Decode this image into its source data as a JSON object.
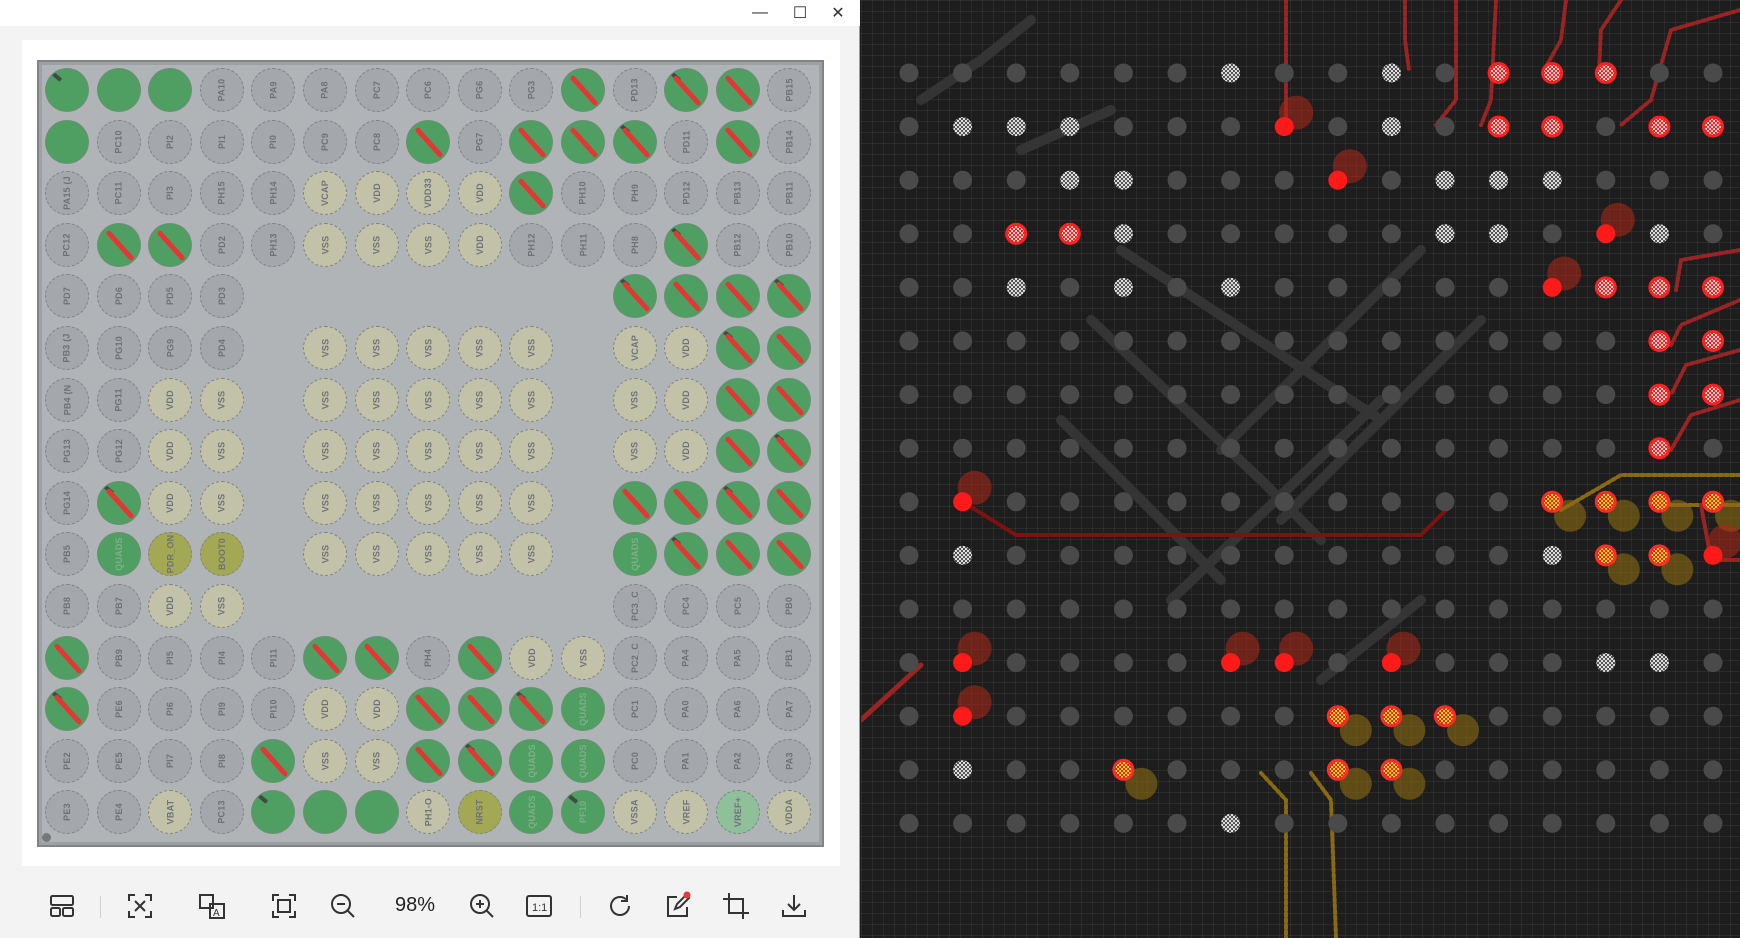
{
  "window": {
    "controls": {
      "minimize": "—",
      "maximize": "☐",
      "close": "✕"
    }
  },
  "colors": {
    "board": "#b1b4b7",
    "pin_gray": "#a4a8ac",
    "pin_power": "#c2c2a8",
    "pin_assigned": "#4f9e62",
    "pin_olive": "#a3a854",
    "route_mark": "#e53535",
    "pcb_background": "#1d1d1d",
    "pad_red": "#ff1a1a",
    "pad_yellow": "#f5e200"
  },
  "pin_grid": {
    "rows": [
      [
        "",
        "",
        "",
        "PA10",
        "PA9",
        "PA8",
        "PC7",
        "PC6",
        "PG6",
        "PG3",
        "",
        "PD13",
        "",
        "",
        "PB15"
      ],
      [
        "",
        "PC10",
        "PI2",
        "PI1",
        "PI0",
        "PC9",
        "PC8",
        "",
        "PG7",
        "",
        "",
        "",
        "PD11",
        "",
        "PB14"
      ],
      [
        "PA15 (J",
        "PC11",
        "PI3",
        "PH15",
        "PH14",
        "VCAP",
        "VDD",
        "VDD33",
        "VDD",
        "",
        "PH10",
        "PH9",
        "PD12",
        "PB13",
        "PB11"
      ],
      [
        "PC12",
        "",
        "",
        "PD2",
        "PH13",
        "VSS",
        "VSS",
        "VSS",
        "VDD",
        "PH12",
        "PH11",
        "PH8",
        "",
        "PB12",
        "PB10"
      ],
      [
        "PD7",
        "PD6",
        "PD5",
        "PD3",
        "",
        "",
        "",
        "",
        "",
        "",
        "",
        "",
        "",
        "",
        ""
      ],
      [
        "PB3 (J",
        "PG10",
        "PG9",
        "PD4",
        "",
        "VSS",
        "VSS",
        "VSS",
        "VSS",
        "VSS",
        "",
        "VCAP",
        "VDD",
        "",
        ""
      ],
      [
        "PB4 (N",
        "PG11",
        "VDD",
        "VSS",
        "",
        "VSS",
        "VSS",
        "VSS",
        "VSS",
        "VSS",
        "",
        "VSS",
        "VDD",
        "",
        ""
      ],
      [
        "PG13",
        "PG12",
        "VDD",
        "VSS",
        "",
        "VSS",
        "VSS",
        "VSS",
        "VSS",
        "VSS",
        "",
        "VSS",
        "VDD",
        "",
        ""
      ],
      [
        "PG14",
        "",
        "VDD",
        "VSS",
        "",
        "VSS",
        "VSS",
        "VSS",
        "VSS",
        "VSS",
        "",
        "",
        "",
        "",
        ""
      ],
      [
        "PB5",
        "QUADS",
        "PDR_ON",
        "BOOT0",
        "",
        "VSS",
        "VSS",
        "VSS",
        "VSS",
        "VSS",
        "",
        "QUADS",
        "",
        "",
        ""
      ],
      [
        "PB8",
        "PB7",
        "VDD",
        "VSS",
        "",
        "",
        "",
        "",
        "",
        "",
        "",
        "PC3_C",
        "PC4",
        "PC5",
        "PB0"
      ],
      [
        "",
        "PB9",
        "PI5",
        "PI4",
        "PI11",
        "",
        "",
        "PH4",
        "",
        "VDD",
        "VSS",
        "PC2_C",
        "PA4",
        "PA5",
        "PB1"
      ],
      [
        "",
        "PE6",
        "PI6",
        "PI9",
        "PI10",
        "VDD",
        "VDD",
        "",
        "",
        "",
        "QUADS",
        "PC1",
        "PA0",
        "PA6",
        "PA7"
      ],
      [
        "PE2",
        "PE5",
        "PI7",
        "PI8",
        "",
        "VSS",
        "VSS",
        "",
        "",
        "QUADS",
        "QUADS",
        "PC0",
        "PA1",
        "PA2",
        "PA3"
      ],
      [
        "PE3",
        "PE4",
        "VBAT",
        "PC13",
        "",
        "",
        "",
        "PH1-O",
        "NRST",
        "QUADS",
        "PF10",
        "VSSA",
        "VREF",
        "VREF+",
        "VDDA"
      ]
    ],
    "kinds": [
      [
        "a",
        "a",
        "a",
        "g",
        "g",
        "g",
        "g",
        "g",
        "g",
        "g",
        "a",
        "g",
        "a",
        "a",
        "g"
      ],
      [
        "a",
        "g",
        "g",
        "g",
        "g",
        "g",
        "g",
        "a",
        "g",
        "a",
        "a",
        "a",
        "g",
        "a",
        "g"
      ],
      [
        "g",
        "g",
        "g",
        "g",
        "g",
        "p",
        "p",
        "p",
        "p",
        "a",
        "g",
        "g",
        "g",
        "g",
        "g"
      ],
      [
        "g",
        "a",
        "a",
        "g",
        "g",
        "p",
        "p",
        "p",
        "p",
        "g",
        "g",
        "g",
        "a",
        "g",
        "g"
      ],
      [
        "g",
        "g",
        "g",
        "g",
        "e",
        "e",
        "e",
        "e",
        "e",
        "e",
        "e",
        "a",
        "a",
        "a",
        "a"
      ],
      [
        "g",
        "g",
        "g",
        "g",
        "e",
        "p",
        "p",
        "p",
        "p",
        "p",
        "e",
        "p",
        "p",
        "a",
        "a"
      ],
      [
        "g",
        "g",
        "p",
        "p",
        "e",
        "p",
        "p",
        "p",
        "p",
        "p",
        "e",
        "p",
        "p",
        "a",
        "a"
      ],
      [
        "g",
        "g",
        "p",
        "p",
        "e",
        "p",
        "p",
        "p",
        "p",
        "p",
        "e",
        "p",
        "p",
        "a",
        "a"
      ],
      [
        "g",
        "a",
        "p",
        "p",
        "e",
        "p",
        "p",
        "p",
        "p",
        "p",
        "e",
        "a",
        "a",
        "a",
        "a"
      ],
      [
        "g",
        "a",
        "o",
        "o",
        "e",
        "p",
        "p",
        "p",
        "p",
        "p",
        "e",
        "a",
        "a",
        "a",
        "a"
      ],
      [
        "g",
        "g",
        "p",
        "p",
        "e",
        "e",
        "e",
        "e",
        "e",
        "e",
        "e",
        "g",
        "g",
        "g",
        "g"
      ],
      [
        "a",
        "g",
        "g",
        "g",
        "g",
        "a",
        "a",
        "g",
        "a",
        "p",
        "p",
        "g",
        "g",
        "g",
        "g"
      ],
      [
        "a",
        "g",
        "g",
        "g",
        "g",
        "p",
        "p",
        "a",
        "a",
        "a",
        "a",
        "g",
        "g",
        "g",
        "g"
      ],
      [
        "g",
        "g",
        "g",
        "g",
        "a",
        "p",
        "p",
        "a",
        "a",
        "a",
        "a",
        "g",
        "g",
        "g",
        "g"
      ],
      [
        "g",
        "g",
        "p",
        "g",
        "a",
        "a",
        "a",
        "p",
        "o",
        "a",
        "a",
        "p",
        "p",
        "m",
        "p"
      ]
    ],
    "routed": [
      [
        0,
        0,
        0,
        0,
        0,
        0,
        0,
        0,
        0,
        0,
        1,
        0,
        1,
        1,
        0
      ],
      [
        0,
        0,
        0,
        0,
        0,
        0,
        0,
        1,
        0,
        1,
        1,
        1,
        0,
        1,
        0
      ],
      [
        0,
        0,
        0,
        0,
        0,
        0,
        0,
        0,
        0,
        1,
        0,
        0,
        0,
        0,
        0
      ],
      [
        0,
        1,
        1,
        0,
        0,
        0,
        0,
        0,
        0,
        0,
        0,
        0,
        1,
        0,
        0
      ],
      [
        0,
        0,
        0,
        0,
        0,
        0,
        0,
        0,
        0,
        0,
        0,
        1,
        1,
        1,
        1
      ],
      [
        0,
        0,
        0,
        0,
        0,
        0,
        0,
        0,
        0,
        0,
        0,
        0,
        0,
        1,
        1
      ],
      [
        0,
        0,
        0,
        0,
        0,
        0,
        0,
        0,
        0,
        0,
        0,
        0,
        0,
        1,
        1
      ],
      [
        0,
        0,
        0,
        0,
        0,
        0,
        0,
        0,
        0,
        0,
        0,
        0,
        0,
        1,
        1
      ],
      [
        0,
        1,
        0,
        0,
        0,
        0,
        0,
        0,
        0,
        0,
        0,
        1,
        1,
        1,
        1
      ],
      [
        0,
        0,
        0,
        0,
        0,
        0,
        0,
        0,
        0,
        0,
        0,
        0,
        1,
        1,
        1
      ],
      [
        0,
        0,
        0,
        0,
        0,
        0,
        0,
        0,
        0,
        0,
        0,
        0,
        0,
        0,
        0
      ],
      [
        1,
        0,
        0,
        0,
        0,
        1,
        1,
        0,
        1,
        0,
        0,
        0,
        0,
        0,
        0
      ],
      [
        1,
        0,
        0,
        0,
        0,
        0,
        0,
        1,
        1,
        1,
        0,
        0,
        0,
        0,
        0
      ],
      [
        0,
        0,
        0,
        0,
        1,
        0,
        0,
        1,
        1,
        0,
        0,
        0,
        0,
        0,
        0
      ],
      [
        0,
        0,
        0,
        0,
        0,
        0,
        0,
        0,
        0,
        0,
        0,
        0,
        0,
        0,
        0
      ]
    ]
  },
  "toolbar": {
    "zoom": "98%"
  },
  "pcb_view": {
    "grid_rows": 15,
    "grid_cols": 15
  }
}
